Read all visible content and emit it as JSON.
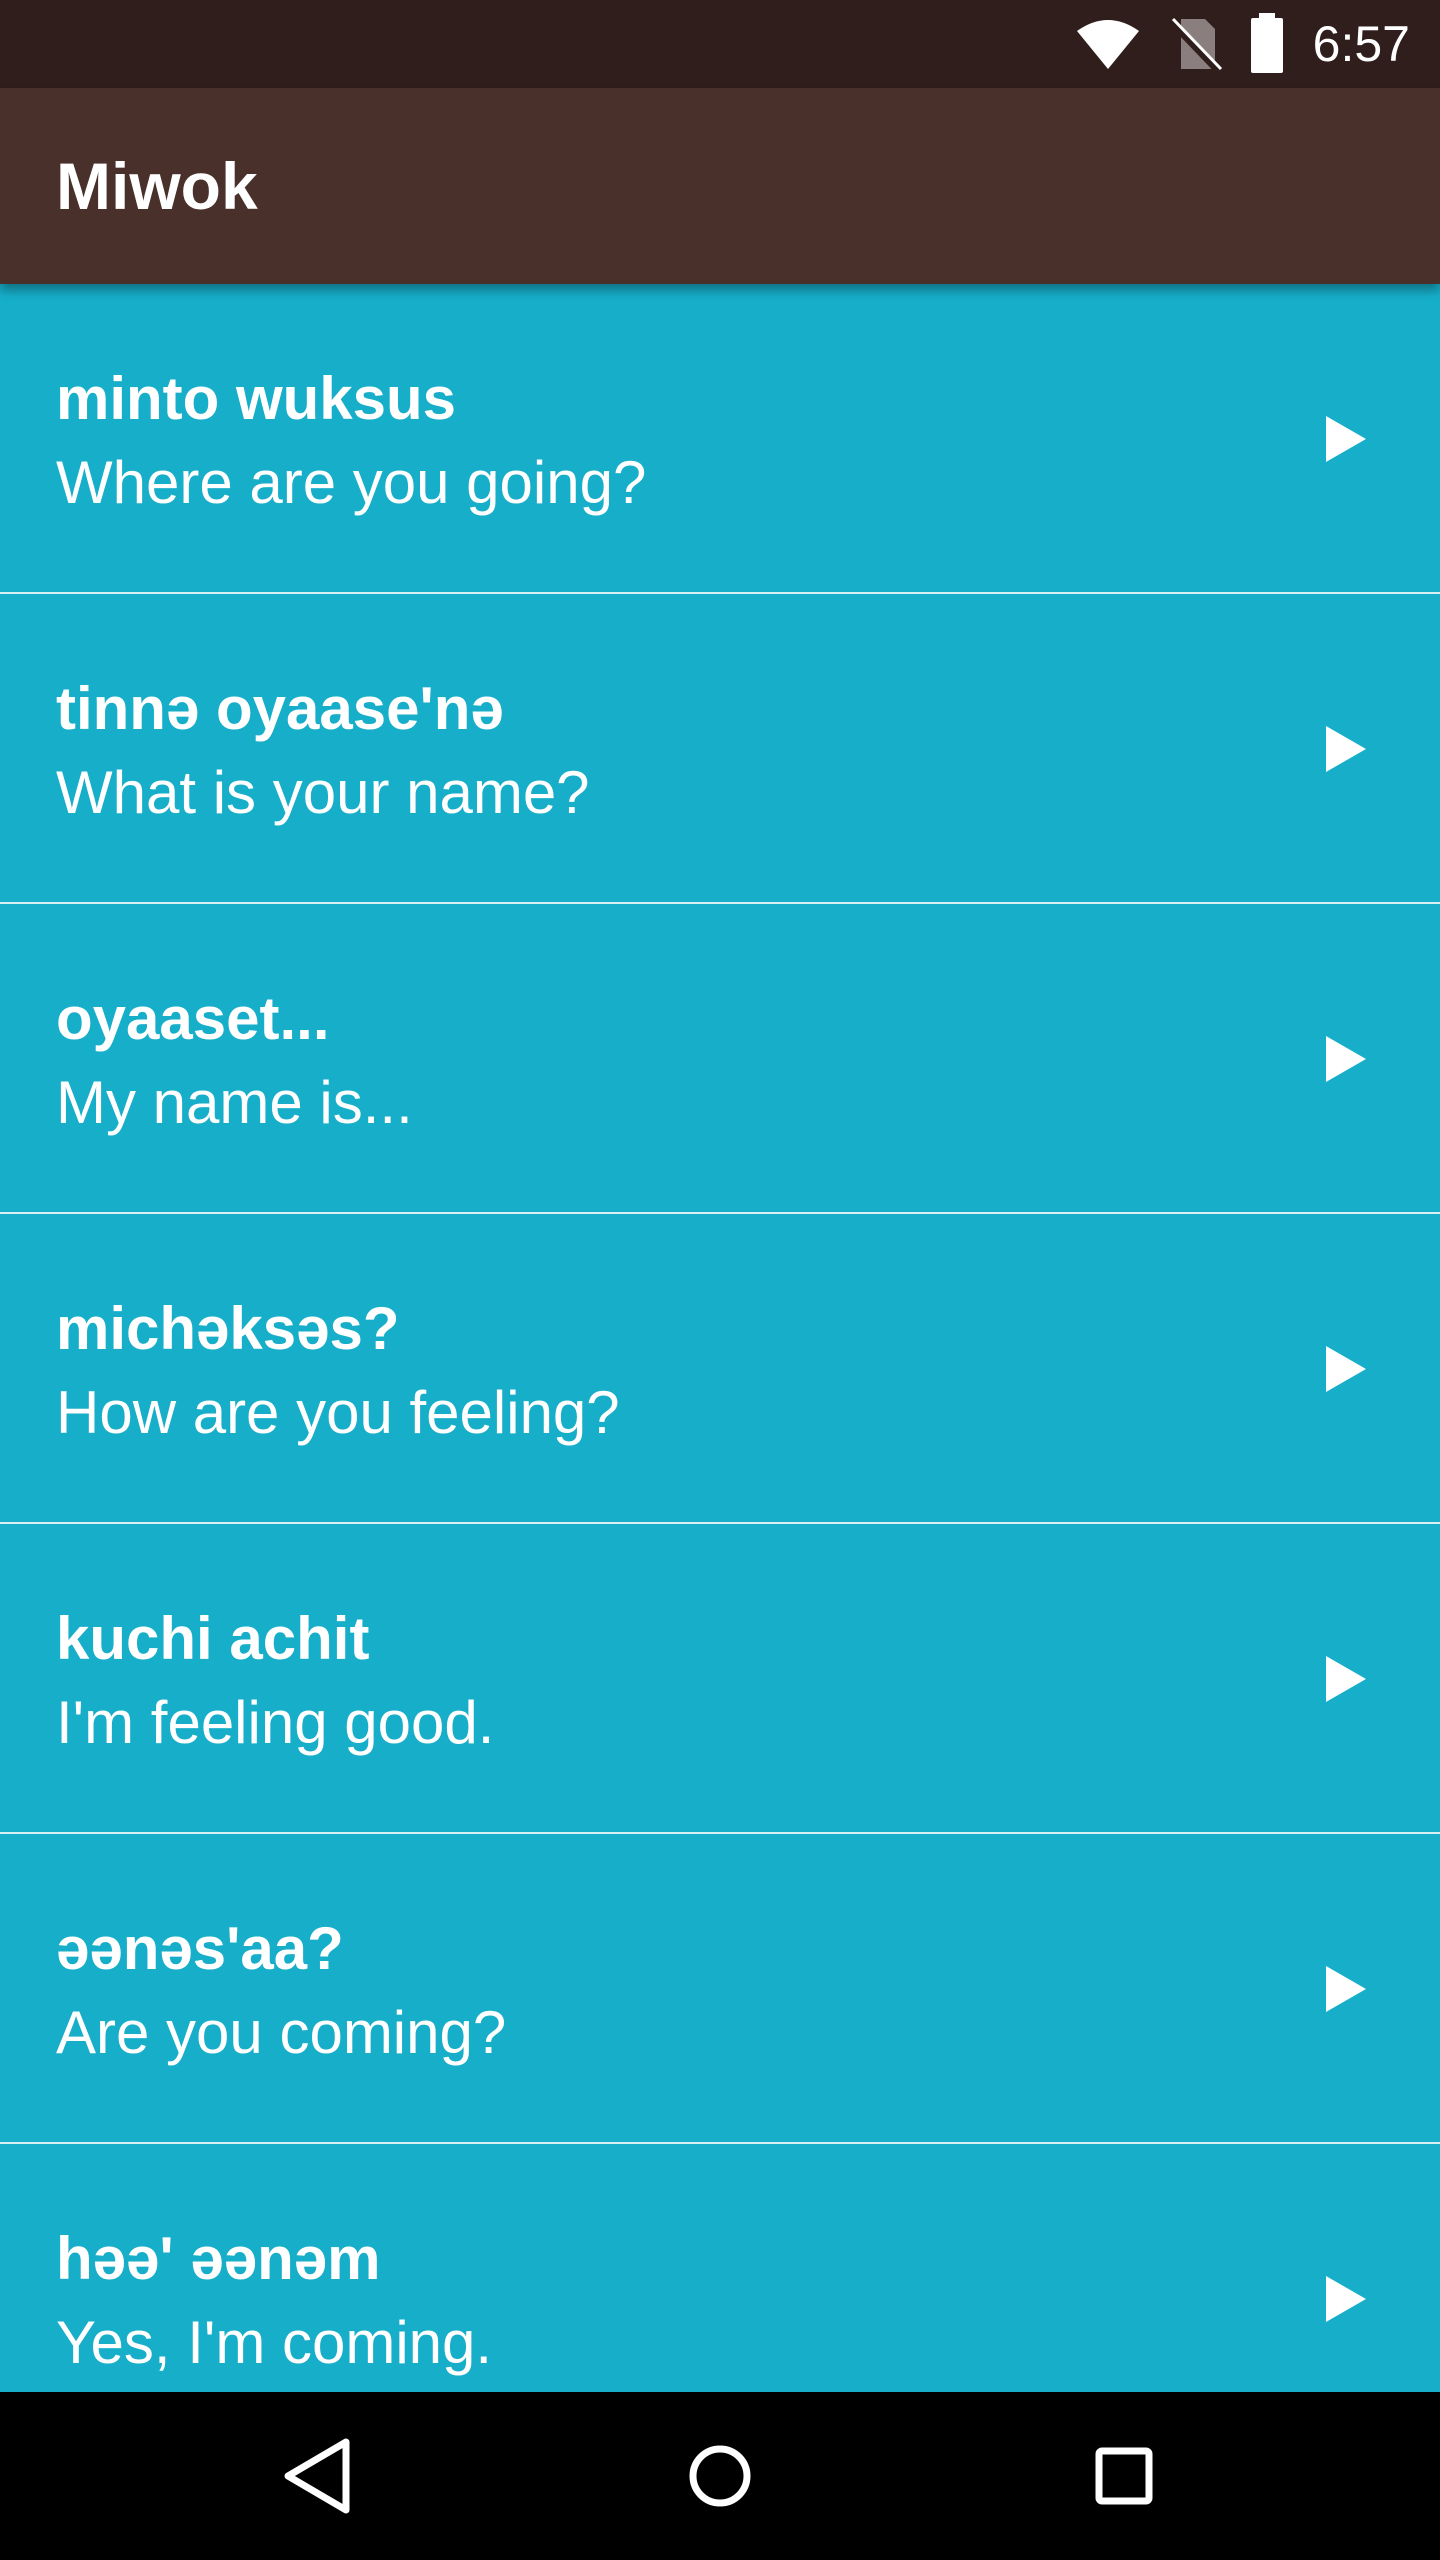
{
  "status_bar": {
    "time": "6:57",
    "icons": [
      "wifi-icon",
      "no-sim-icon",
      "battery-icon"
    ]
  },
  "app_bar": {
    "title": "Miwok"
  },
  "colors": {
    "status_bar": "#301E1C",
    "app_bar": "#4A302A",
    "list_background": "#16AEC9",
    "text": "#FFFFFF"
  },
  "phrases": [
    {
      "miwok": "minto wuksus",
      "english": "Where are you going?"
    },
    {
      "miwok": "tinnə oyaase'nə",
      "english": "What is your name?"
    },
    {
      "miwok": "oyaaset...",
      "english": "My name is..."
    },
    {
      "miwok": "michəksəs?",
      "english": "How are you feeling?"
    },
    {
      "miwok": "kuchi achit",
      "english": "I'm feeling good."
    },
    {
      "miwok": "əənəs'aa?",
      "english": "Are you coming?"
    },
    {
      "miwok": "həə' əənəm",
      "english": "Yes, I'm coming."
    }
  ],
  "nav_bar": {
    "buttons": [
      "back-icon",
      "home-icon",
      "recents-icon"
    ]
  }
}
